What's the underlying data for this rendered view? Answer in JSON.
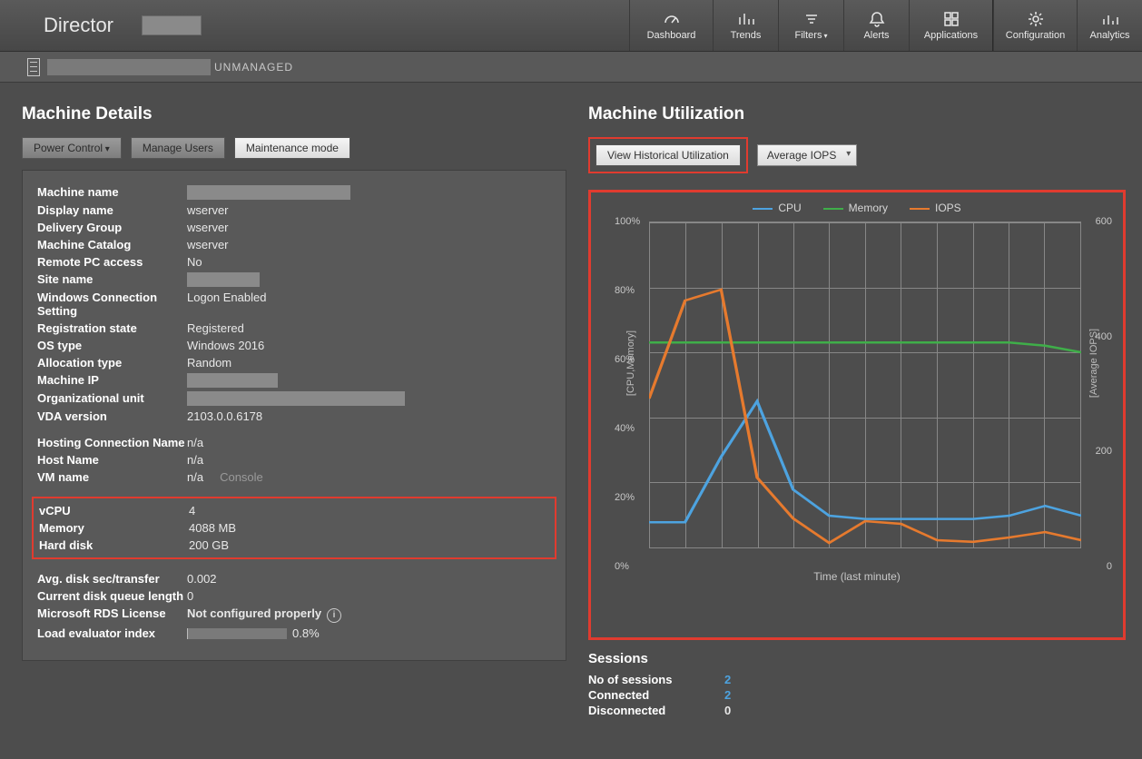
{
  "brand": "Director",
  "nav": {
    "dashboard": "Dashboard",
    "trends": "Trends",
    "filters": "Filters",
    "alerts": "Alerts",
    "applications": "Applications",
    "configuration": "Configuration",
    "analytics": "Analytics"
  },
  "breadcrumb": {
    "status": "UNMANAGED"
  },
  "left": {
    "title": "Machine Details",
    "buttons": {
      "power": "Power Control",
      "manage_users": "Manage Users",
      "maintenance": "Maintenance mode"
    },
    "rows": {
      "machine_name": "Machine name",
      "display_name": "Display name",
      "display_name_v": "wserver",
      "delivery_group": "Delivery Group",
      "delivery_group_v": "wserver",
      "machine_catalog": "Machine Catalog",
      "machine_catalog_v": "wserver",
      "remote_pc": "Remote PC access",
      "remote_pc_v": "No",
      "site_name": "Site name",
      "win_conn": "Windows Connection Setting",
      "win_conn_v": "Logon Enabled",
      "reg_state": "Registration state",
      "reg_state_v": "Registered",
      "os_type": "OS type",
      "os_type_v": "Windows 2016",
      "alloc": "Allocation type",
      "alloc_v": "Random",
      "machine_ip": "Machine IP",
      "ou": "Organizational unit",
      "vda": "VDA version",
      "vda_v": "2103.0.0.6178",
      "hosting": "Hosting Connection Name",
      "hosting_v": "n/a",
      "host_name": "Host Name",
      "host_name_v": "n/a",
      "vm_name": "VM name",
      "vm_name_v": "n/a",
      "console": "Console",
      "vcpu": "vCPU",
      "vcpu_v": "4",
      "memory": "Memory",
      "memory_v": "4088 MB",
      "hdd": "Hard disk",
      "hdd_v": "200 GB",
      "avg_disk": "Avg. disk sec/transfer",
      "avg_disk_v": "0.002",
      "queue": "Current disk queue length",
      "queue_v": "0",
      "rds": "Microsoft RDS License",
      "rds_v": "Not configured properly",
      "load": "Load evaluator index",
      "load_v": "0.8%"
    }
  },
  "right": {
    "title": "Machine Utilization",
    "view_hist": "View Historical Utilization",
    "iops_select": "Average IOPS",
    "legend": {
      "cpu": "CPU",
      "mem": "Memory",
      "iops": "IOPS"
    },
    "yl": [
      "0%",
      "20%",
      "40%",
      "60%",
      "80%",
      "100%"
    ],
    "yr": [
      "0",
      "200",
      "400",
      "600"
    ],
    "y_left_title": "[CPU,Memory]",
    "y_right_title": "[Average IOPS]",
    "x_title": "Time (last minute)"
  },
  "sessions": {
    "title": "Sessions",
    "no": "No of sessions",
    "no_v": "2",
    "connected": "Connected",
    "connected_v": "2",
    "disconnected": "Disconnected",
    "disconnected_v": "0"
  },
  "chart_data": {
    "type": "line",
    "x": [
      0,
      1,
      2,
      3,
      4,
      5,
      6,
      7,
      8,
      9,
      10,
      11,
      12
    ],
    "series": [
      {
        "name": "CPU",
        "unit": "%",
        "values": [
          8,
          8,
          28,
          45,
          18,
          10,
          9,
          9,
          9,
          9,
          10,
          13,
          10
        ]
      },
      {
        "name": "Memory",
        "unit": "%",
        "values": [
          63,
          63,
          63,
          63,
          63,
          63,
          63,
          63,
          63,
          63,
          63,
          62,
          60
        ]
      },
      {
        "name": "IOPS",
        "unit": "count",
        "yaxis": "right",
        "values": [
          275,
          455,
          475,
          130,
          55,
          10,
          50,
          45,
          15,
          12,
          20,
          30,
          15
        ]
      }
    ],
    "ylim_left": [
      0,
      100
    ],
    "ylim_right": [
      0,
      600
    ],
    "xlabel": "Time (last minute)",
    "ylabel_left": "[CPU,Memory]",
    "ylabel_right": "[Average IOPS]"
  }
}
